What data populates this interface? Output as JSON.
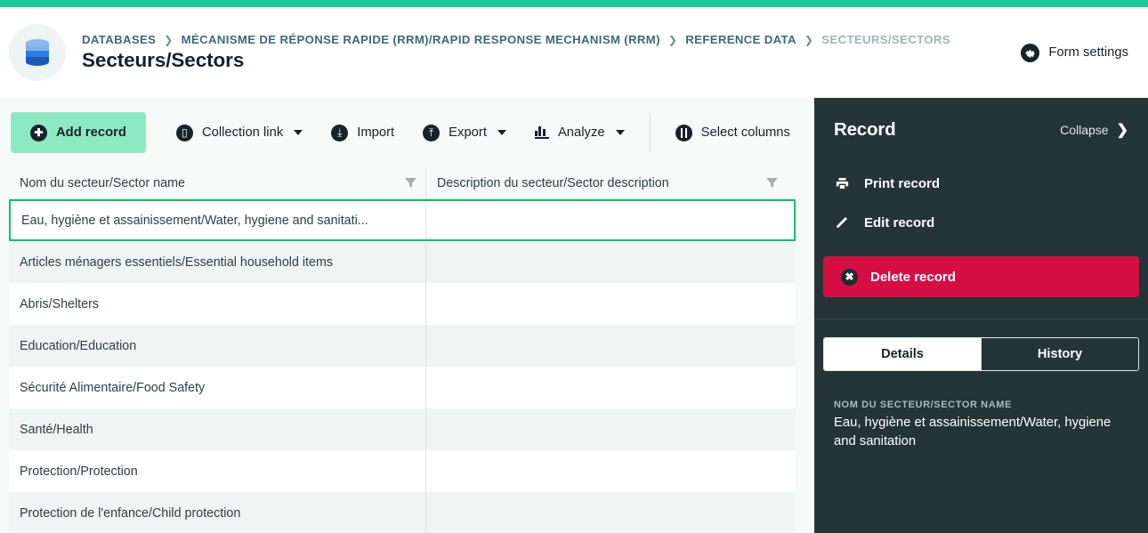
{
  "theme": {
    "accent_bar": "#1ec99c",
    "primary_button": "#8de9c2",
    "selected_row_border": "#09c167",
    "delete_button": "#d50f44",
    "panel_dark": "#253436"
  },
  "header": {
    "db_icon": "database-cylinder-icon",
    "breadcrumb": [
      {
        "label": "DATABASES",
        "current": false
      },
      {
        "label": "MÉCANISME DE RÉPONSE RAPIDE (RRM)/RAPID RESPONSE MECHANISM (RRM)",
        "current": false
      },
      {
        "label": "REFERENCE DATA",
        "current": false
      },
      {
        "label": "SECTEURS/SECTORS",
        "current": true
      }
    ],
    "separator": "❯",
    "page_title": "Secteurs/Sectors",
    "form_settings_label": "Form settings",
    "form_settings_icon": "gear-icon"
  },
  "toolbar": {
    "add_record": {
      "label": "Add record",
      "icon": "plus-circle-icon"
    },
    "collection_link": {
      "label": "Collection link",
      "icon": "collection-icon",
      "has_caret": true
    },
    "import": {
      "label": "Import",
      "icon": "download-circle-icon"
    },
    "export": {
      "label": "Export",
      "icon": "upload-circle-icon",
      "has_caret": true
    },
    "analyze": {
      "label": "Analyze",
      "icon": "bar-chart-icon",
      "has_caret": true
    },
    "select_columns": {
      "label": "Select columns",
      "icon": "columns-circle-icon"
    }
  },
  "table": {
    "columns": [
      {
        "label": "Nom du secteur/Sector name",
        "filter_icon": "filter-icon"
      },
      {
        "label": "Description du secteur/Sector description",
        "filter_icon": "filter-icon"
      }
    ],
    "rows": [
      {
        "name": "Eau, hygiène et assainissement/Water, hygiene and sanitati...",
        "description": "",
        "selected": true
      },
      {
        "name": "Articles ménagers essentiels/Essential household items",
        "description": "",
        "selected": false
      },
      {
        "name": "Abris/Shelters",
        "description": "",
        "selected": false
      },
      {
        "name": "Education/Education",
        "description": "",
        "selected": false
      },
      {
        "name": "Sécurité Alimentaire/Food Safety",
        "description": "",
        "selected": false
      },
      {
        "name": "Santé/Health",
        "description": "",
        "selected": false
      },
      {
        "name": "Protection/Protection",
        "description": "",
        "selected": false
      },
      {
        "name": "Protection de l'enfance/Child protection",
        "description": "",
        "selected": false
      }
    ]
  },
  "record_panel": {
    "title": "Record",
    "collapse_label": "Collapse",
    "collapse_icon": "chevron-right-icon",
    "actions": [
      {
        "label": "Print record",
        "icon": "printer-icon"
      },
      {
        "label": "Edit record",
        "icon": "pencil-icon"
      }
    ],
    "delete": {
      "label": "Delete record",
      "icon": "x-circle-icon"
    },
    "tabs": [
      {
        "label": "Details",
        "active": true
      },
      {
        "label": "History",
        "active": false
      }
    ],
    "details": {
      "field_label": "NOM DU SECTEUR/SECTOR NAME",
      "field_value": "Eau, hygiène et assainissement/Water, hygiene and sanitation"
    }
  }
}
